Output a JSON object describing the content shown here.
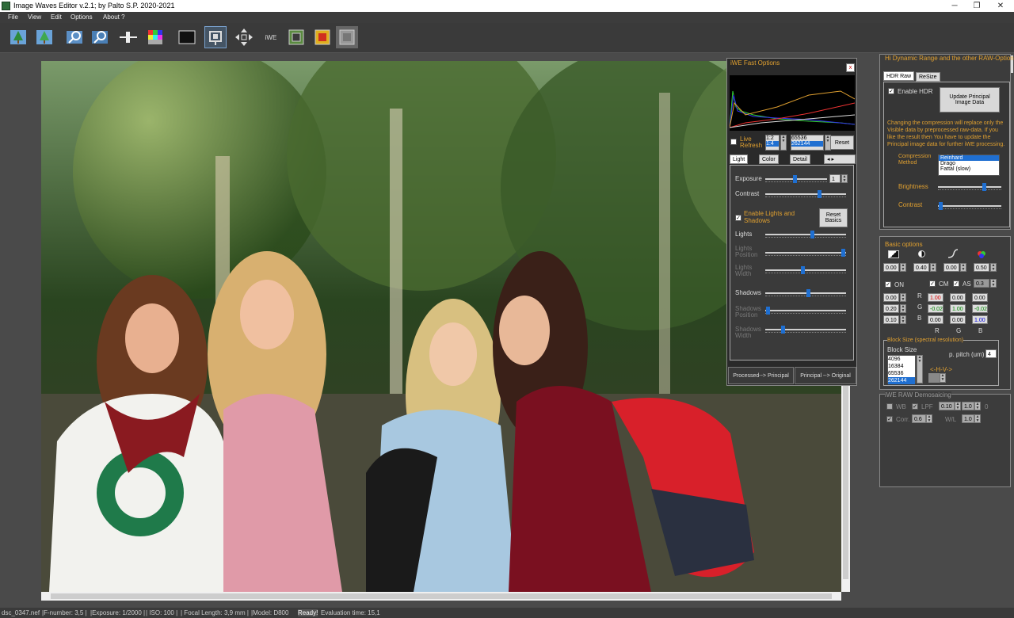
{
  "window": {
    "title": "Image Waves Editor  v.2.1; by Palto S.P.  2020-2021",
    "min": "─",
    "max": "❐",
    "close": "✕"
  },
  "menu": [
    "File",
    "View",
    "Edit",
    "Options",
    "About ?"
  ],
  "toolbar": {
    "iwe_label": "iWE"
  },
  "fast": {
    "title": "iWE Fast Options",
    "close": "x",
    "live": "Live",
    "refresh": "Refresh",
    "ratio1": "1:2",
    "ratio2": "1:4",
    "size1": "65536",
    "size2": "262144",
    "reset": "Reset",
    "tabs": [
      "Light",
      "Color",
      "Detail"
    ],
    "exposure": "Exposure",
    "exposure_val": "1",
    "contrast": "Contrast",
    "enable_ls": "Enable Lights and Shadows",
    "reset_basics_1": "Reset",
    "reset_basics_2": "Basics",
    "lights": "Lights",
    "lights_pos_1": "Lights",
    "lights_pos_2": "Position",
    "lights_w_1": "Lights",
    "lights_w_2": "Width",
    "shadows": "Shadows",
    "shadows_pos_1": "Shadows",
    "shadows_pos_2": "Position",
    "shadows_w_1": "Shadows",
    "shadows_w_2": "Width",
    "proc_principal": "Processed--> Principal",
    "principal_orig": "Principal --> Original"
  },
  "hdr": {
    "title": "Hi Dynamic Range and the other RAW-Options",
    "tab1": "HDR Raw",
    "tab2": "ReSize",
    "enable": "Enable HDR",
    "update_1": "Update Principal",
    "update_2": "Image Data",
    "note": "Changing the compression  will replace only the Visible data by  preprocessed raw-data.  If you like the result then You have to update the Principal image data for further iWE processing.",
    "comp_1": "Compression",
    "comp_2": "Method",
    "methods": [
      "Reinhard",
      "Drago",
      "Fattal (slow)"
    ],
    "brightness": "Brightness",
    "contrast": "Contrast"
  },
  "basic": {
    "title": "Basic options",
    "v1": "0.00",
    "v2": "0.40",
    "v3": "0.00",
    "v4": "0.50",
    "on": "ON",
    "cm": "CM",
    "as": "AS",
    "as_val": "0.3",
    "left": [
      "0.00",
      "0.20",
      "0.10"
    ],
    "r": "R",
    "g": "G",
    "b": "B",
    "matrix": [
      [
        "1.00",
        "0.00",
        "0.00"
      ],
      [
        "-0.02",
        "1.00",
        "-0.02"
      ],
      [
        "0.00",
        "0.00",
        "1.00"
      ]
    ],
    "block_title": "Block Size (spectral resolution)",
    "block_label": "Block Size",
    "pitch": "p. pitch (um)",
    "pitch_val": "4",
    "sizes": [
      "4096",
      "16384",
      "65536",
      "262144"
    ],
    "hv": "<-H-V->"
  },
  "demosaic": {
    "title": "iWE RAW Demosaicing",
    "wb": "WB",
    "lpf": "LPF",
    "lpf1": "0.10",
    "lpf2": "1.0",
    "zero": "0",
    "corr": "Corr.",
    "corr_v": "0.6",
    "wl": "W/L",
    "wl_v": "1.0"
  },
  "status": {
    "file": "dsc_0347.nef",
    "fnum": "|F-number: 3,5 |",
    "exposure": "|Exposure: 1/2000 |",
    "iso": "| ISO: 100 |",
    "focal": "| Focal Length: 3,9 mm |",
    "model": "|Model: D800",
    "ready": "Ready!",
    "eval": "Evaluation time: 15,1"
  },
  "colors": {
    "accent": "#1f6fd1",
    "orange": "#e0a030",
    "bg": "#4a4a4a"
  }
}
